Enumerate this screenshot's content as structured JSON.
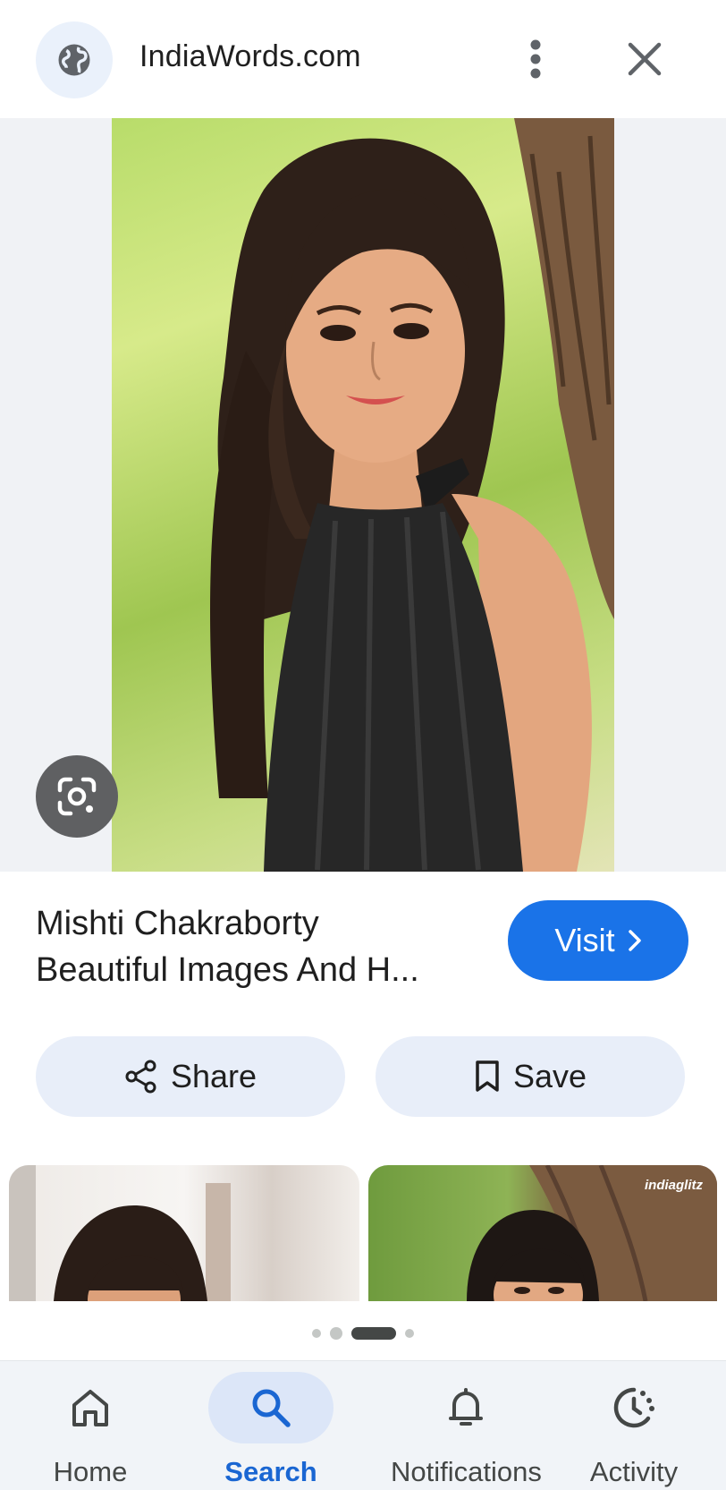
{
  "header": {
    "site_name": "IndiaWords.com",
    "site_icon": "globe-icon",
    "more_icon": "more-vert-icon",
    "close_icon": "close-icon"
  },
  "result": {
    "title_line1": "Mishti Chakraborty",
    "title_line2": "Beautiful Images And H...",
    "visit_label": "Visit",
    "visit_icon": "chevron-right-icon",
    "lens_icon": "lens-icon"
  },
  "actions": {
    "share_label": "Share",
    "share_icon": "share-icon",
    "save_label": "Save",
    "save_icon": "bookmark-icon"
  },
  "related": {
    "thumb2_brand": "indiaglitz"
  },
  "pager": {
    "count": 4,
    "active_index": 2
  },
  "nav": {
    "items": [
      {
        "label": "Home",
        "icon": "home-icon",
        "active": false
      },
      {
        "label": "Search",
        "icon": "search-icon",
        "active": true
      },
      {
        "label": "Notifications",
        "icon": "bell-icon",
        "active": false
      },
      {
        "label": "Activity",
        "icon": "activity-icon",
        "active": false
      }
    ]
  },
  "colors": {
    "accent": "#1a73e8",
    "pill_bg": "#e8eef9",
    "nav_bg": "#f1f4f8"
  }
}
